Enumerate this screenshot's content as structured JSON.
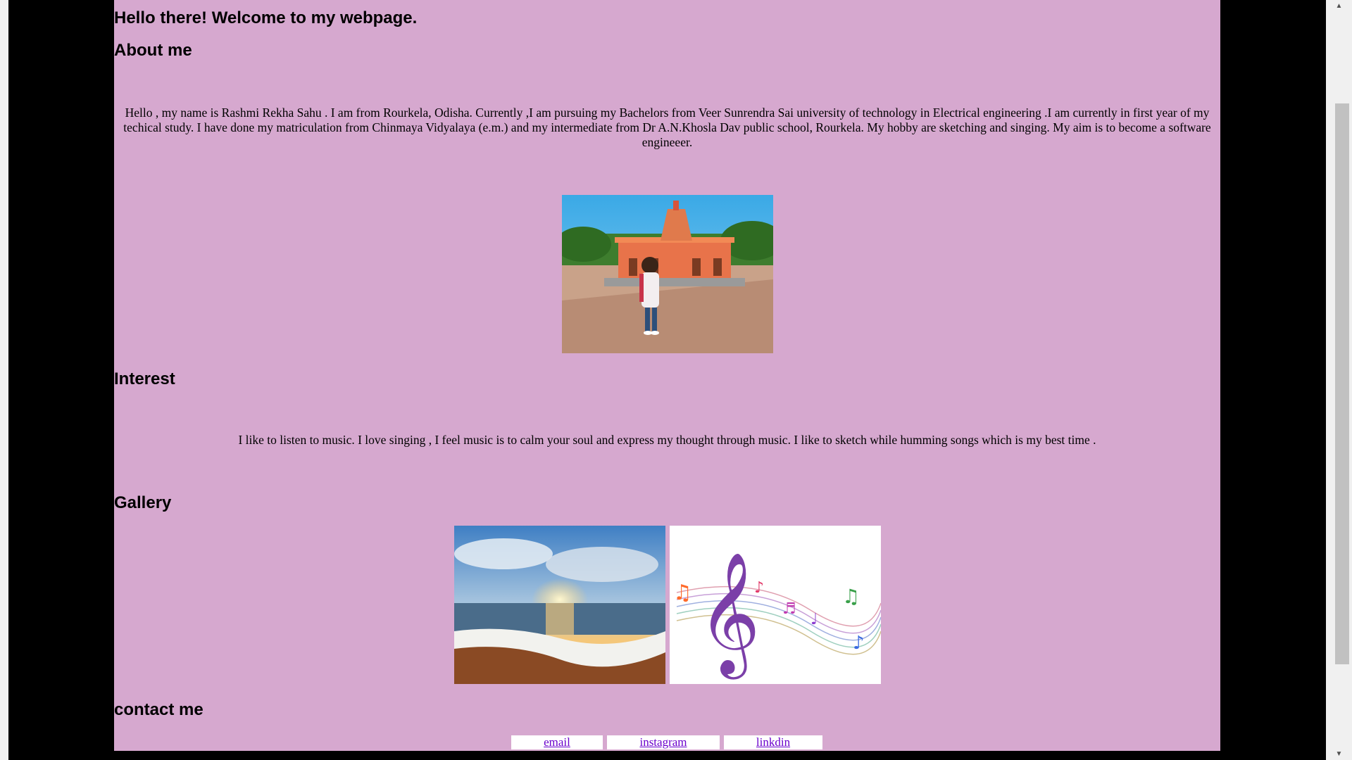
{
  "page": {
    "title": "Hello there! Welcome to my webpage."
  },
  "about": {
    "heading": "About me",
    "text": "Hello , my name is Rashmi Rekha Sahu . I am from Rourkela, Odisha. Currently ,I am pursuing my Bachelors from Veer Sunrendra Sai university of technology in Electrical engineering .I am currently in first year of my techical study. I have done my matriculation from Chinmaya Vidyalaya (e.m.) and my intermediate from Dr A.N.Khosla Dav public school, Rourkela. My hobby are sketching and singing. My aim is to become a software engineeer."
  },
  "interest": {
    "heading": "Interest",
    "text": "I like to listen to music. I love singing , I feel music is to calm your soul and express my thought through music. I like to sketch while humming songs which is my best time ."
  },
  "gallery": {
    "heading": "Gallery"
  },
  "contact": {
    "heading": "contact me",
    "links": [
      "email",
      "instagram",
      "linkdin"
    ]
  },
  "colors": {
    "page_background": "#d6a8cf",
    "outer_background": "#000000",
    "link": "#6a00cc",
    "link_box": "#ffffff"
  },
  "icons": {
    "scroll_up": "▲",
    "scroll_down": "▼"
  }
}
